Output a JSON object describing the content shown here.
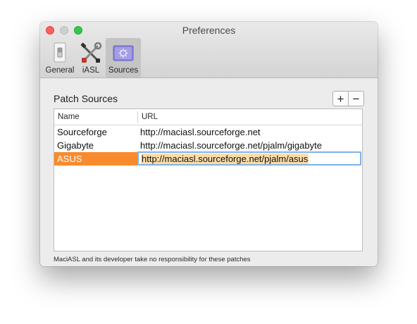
{
  "window": {
    "title": "Preferences"
  },
  "toolbar": {
    "tabs": [
      {
        "label": "General",
        "icon": "switch-icon",
        "selected": false
      },
      {
        "label": "iASL",
        "icon": "tools-icon",
        "selected": false
      },
      {
        "label": "Sources",
        "icon": "sources-icon",
        "selected": true
      }
    ]
  },
  "patch_sources": {
    "title": "Patch Sources",
    "add_label": "+",
    "remove_label": "−",
    "columns": [
      "Name",
      "URL"
    ],
    "rows": [
      {
        "name": "Sourceforge",
        "url": "http://maciasl.sourceforge.net"
      },
      {
        "name": "Gigabyte",
        "url": "http://maciasl.sourceforge.net/pjalm/gigabyte"
      },
      {
        "name": "ASUS",
        "url": "http://maciasl.sourceforge.net/pjalm/asus"
      }
    ],
    "selected_row": 2
  },
  "footnote": "MaciASL and its developer take no responsibility for these patches",
  "colors": {
    "selection": "#f78b2d",
    "focus_ring": "#7eb2ea",
    "text_highlight": "#fcdca8"
  }
}
